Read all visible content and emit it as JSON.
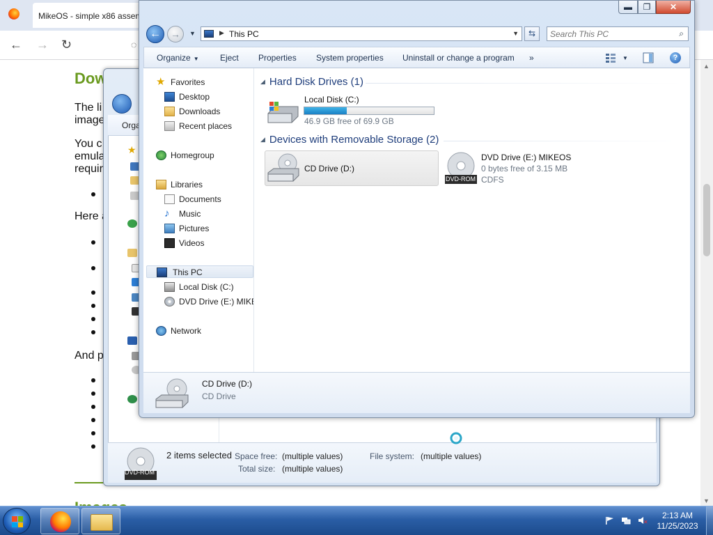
{
  "browser": {
    "tab_title": "MikeOS - simple x86 assem",
    "page_heading": "Dow",
    "para1_line1": "The li",
    "para1_line2": "image",
    "para2_line1": "You c",
    "para2_line2": "emula",
    "para2_line3": "requir",
    "para3": "Here a",
    "para4": "And p",
    "section_heading": "Images"
  },
  "back_window": {
    "organize": "Orga",
    "selection_count": "2 items selected",
    "space_free_label": "Space free:",
    "space_free_value": "(multiple values)",
    "total_size_label": "Total size:",
    "total_size_value": "(multiple values)",
    "file_system_label": "File system:",
    "file_system_value": "(multiple values)",
    "dvd_badge": "DVD-ROM"
  },
  "window": {
    "address": "This PC",
    "search_placeholder": "Search This PC",
    "toolbar": [
      "Organize",
      "Eject",
      "Properties",
      "System properties",
      "Uninstall or change a program"
    ],
    "toolbar_more": "»",
    "nav": {
      "favorites": "Favorites",
      "desktop": "Desktop",
      "downloads": "Downloads",
      "recent": "Recent places",
      "homegroup": "Homegroup",
      "libraries": "Libraries",
      "documents": "Documents",
      "music": "Music",
      "pictures": "Pictures",
      "videos": "Videos",
      "thispc": "This PC",
      "localdisk": "Local Disk (C:)",
      "dvddrive": "DVD Drive (E:) MIKEOS",
      "network": "Network"
    },
    "groups": {
      "hdd": "Hard Disk Drives (1)",
      "removable": "Devices with Removable Storage (2)"
    },
    "drives": {
      "c_name": "Local Disk (C:)",
      "c_free": "46.9 GB free of 69.9 GB",
      "c_used_fraction": 0.33,
      "d_name": "CD Drive (D:)",
      "e_name": "DVD Drive (E:) MIKEOS",
      "e_free": "0 bytes free of 3.15 MB",
      "e_fs": "CDFS",
      "e_badge": "DVD-ROM"
    },
    "details": {
      "name": "CD Drive (D:)",
      "type": "CD Drive"
    }
  },
  "taskbar": {
    "time": "2:13 AM",
    "date": "11/25/2023"
  }
}
